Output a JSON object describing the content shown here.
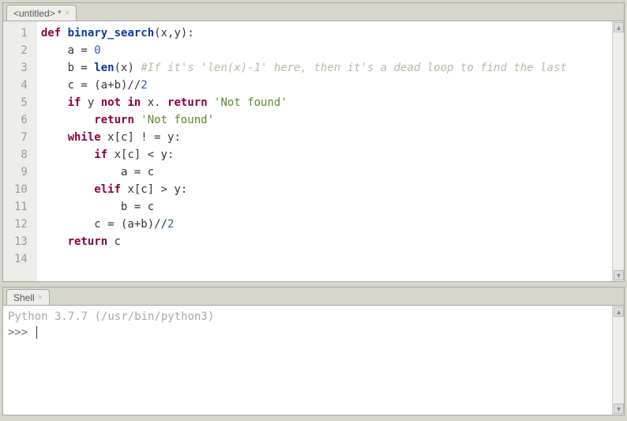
{
  "editor": {
    "tab_label": "<untitled> *",
    "line_numbers": [
      "1",
      "2",
      "3",
      "4",
      "5",
      "6",
      "7",
      "8",
      "9",
      "10",
      "11",
      "12",
      "13",
      "14"
    ],
    "code": {
      "l1_def": "def",
      "l1_fn": "binary_search",
      "l1_rest": "(x,y):",
      "l2_pre": "    a = ",
      "l2_num": "0",
      "l3_pre": "    b = ",
      "l3_len": "len",
      "l3_mid": "(x) ",
      "l3_cmt": "#If it's 'len(x)-1' here, then it's a dead loop to find the last",
      "l4_pre": "    c = (a+b)//",
      "l4_num": "2",
      "l5_if": "if",
      "l5_mid1": " y ",
      "l5_not": "not",
      "l5_mid2": " ",
      "l5_in": "in",
      "l5_mid3": " x. ",
      "l5_ret": "return",
      "l5_str": " 'Not found'",
      "l6_ret": "return",
      "l6_str": " 'Not found'",
      "l7_while": "while",
      "l7_rest": " x[c] ! = y:",
      "l8_if": "if",
      "l8_rest": " x[c] < y:",
      "l9": "            a = c",
      "l10_elif": "elif",
      "l10_rest": " x[c] > y:",
      "l11": "            b = c",
      "l12_pre": "        c = (a+b)//",
      "l12_num": "2",
      "l13_ret": "return",
      "l13_rest": " c"
    }
  },
  "shell": {
    "tab_label": "Shell",
    "banner": "Python 3.7.7 (/usr/bin/python3)",
    "prompt": ">>> "
  }
}
